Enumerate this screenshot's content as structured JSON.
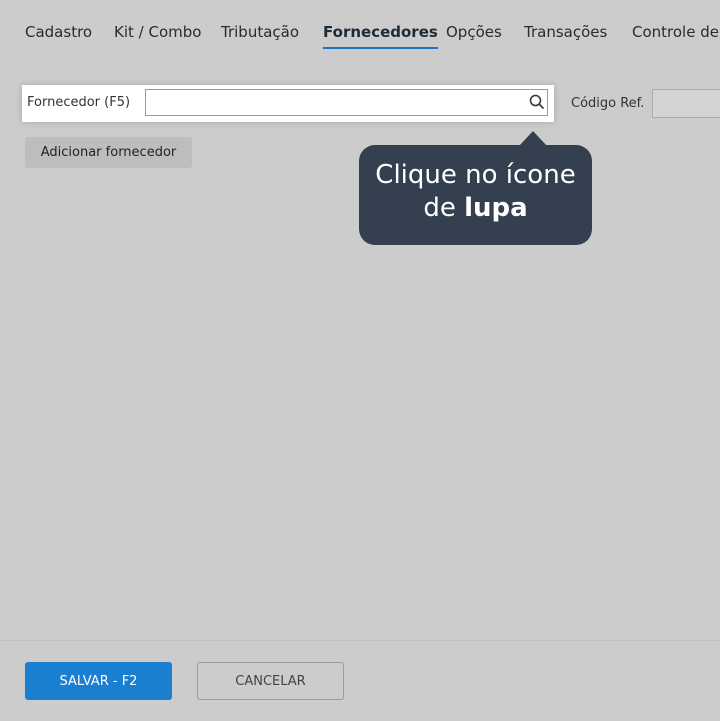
{
  "tabs": [
    {
      "label": "Cadastro"
    },
    {
      "label": "Kit / Combo"
    },
    {
      "label": "Tributação"
    },
    {
      "label": "Fornecedores",
      "active": true
    },
    {
      "label": "Opções"
    },
    {
      "label": "Transações"
    },
    {
      "label": "Controle de"
    }
  ],
  "supplier": {
    "label": "Fornecedor (F5)",
    "value": "",
    "search_icon": "search-icon"
  },
  "ref": {
    "label": "Código Ref.",
    "value": ""
  },
  "add_supplier_label": "Adicionar fornecedor",
  "tooltip": {
    "line1": "Clique no ícone",
    "line2_prefix": "de ",
    "line2_bold": "lupa"
  },
  "footer": {
    "save_label": "SALVAR - F2",
    "cancel_label": "CANCELAR"
  },
  "colors": {
    "accent": "#1a7fd1",
    "tooltip_bg": "#34404f",
    "background": "#cccccc"
  }
}
